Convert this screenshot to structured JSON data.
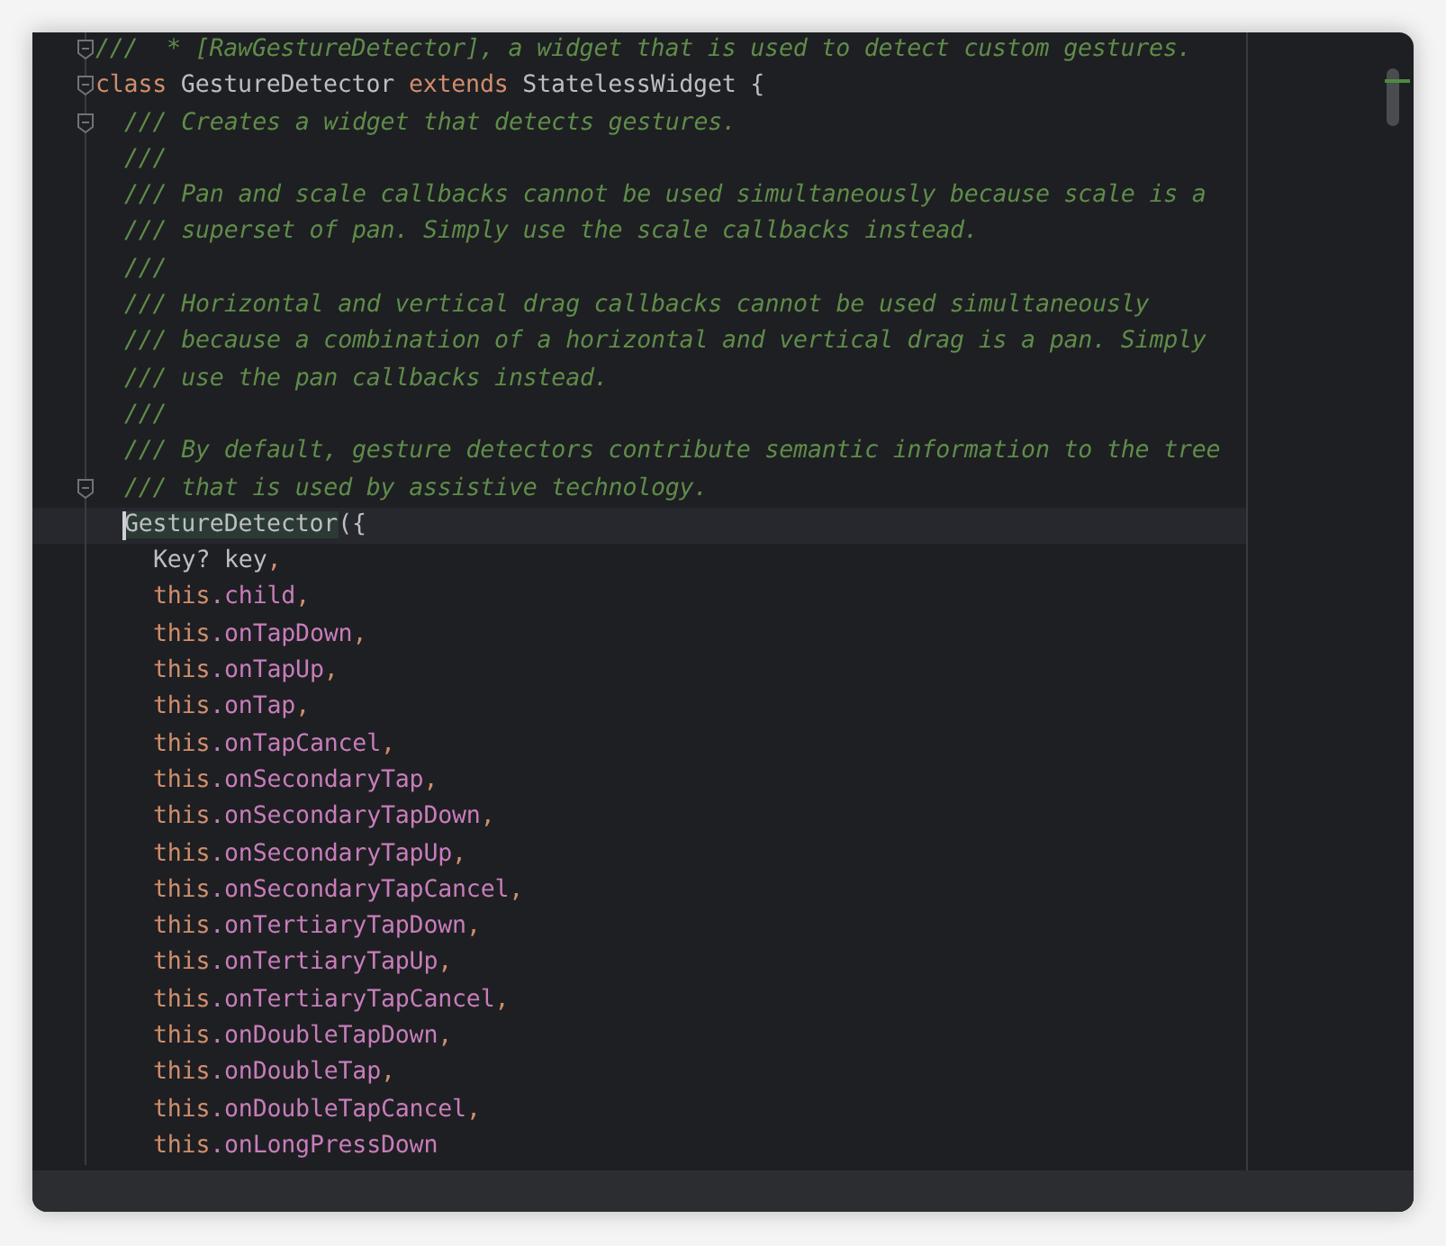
{
  "editor": {
    "lines": [
      {
        "kind": "top",
        "fold": true,
        "current": false,
        "tokens": [
          {
            "kind": "comment",
            "text": "///  * [RawGestureDetector], a widget that is used to detect custom gestures."
          }
        ]
      },
      {
        "kind": "top",
        "fold": true,
        "current": false,
        "tokens": [
          {
            "kind": "keyword",
            "text": "class"
          },
          {
            "kind": "plain",
            "text": " GestureDetector "
          },
          {
            "kind": "keyword",
            "text": "extends"
          },
          {
            "kind": "plain",
            "text": " StatelessWidget {"
          }
        ]
      },
      {
        "kind": "body",
        "fold": true,
        "current": false,
        "tokens": [
          {
            "kind": "comment",
            "text": "/// Creates a widget that detects gestures."
          }
        ]
      },
      {
        "kind": "body",
        "fold": false,
        "current": false,
        "tokens": [
          {
            "kind": "comment",
            "text": "///"
          }
        ]
      },
      {
        "kind": "body",
        "fold": false,
        "current": false,
        "tokens": [
          {
            "kind": "comment",
            "text": "/// Pan and scale callbacks cannot be used simultaneously because scale is a"
          }
        ]
      },
      {
        "kind": "body",
        "fold": false,
        "current": false,
        "tokens": [
          {
            "kind": "comment",
            "text": "/// superset of pan. Simply use the scale callbacks instead."
          }
        ]
      },
      {
        "kind": "body",
        "fold": false,
        "current": false,
        "tokens": [
          {
            "kind": "comment",
            "text": "///"
          }
        ]
      },
      {
        "kind": "body",
        "fold": false,
        "current": false,
        "tokens": [
          {
            "kind": "comment",
            "text": "/// Horizontal and vertical drag callbacks cannot be used simultaneously"
          }
        ]
      },
      {
        "kind": "body",
        "fold": false,
        "current": false,
        "tokens": [
          {
            "kind": "comment",
            "text": "/// because a combination of a horizontal and vertical drag is a pan. Simply"
          }
        ]
      },
      {
        "kind": "body",
        "fold": false,
        "current": false,
        "tokens": [
          {
            "kind": "comment",
            "text": "/// use the pan callbacks instead."
          }
        ]
      },
      {
        "kind": "body",
        "fold": false,
        "current": false,
        "tokens": [
          {
            "kind": "comment",
            "text": "///"
          }
        ]
      },
      {
        "kind": "body",
        "fold": false,
        "current": false,
        "tokens": [
          {
            "kind": "comment",
            "text": "/// By default, gesture detectors contribute semantic information to the tree"
          }
        ]
      },
      {
        "kind": "body",
        "fold": true,
        "current": false,
        "tokens": [
          {
            "kind": "comment",
            "text": "/// that is used by assistive technology."
          }
        ]
      },
      {
        "kind": "body",
        "fold": false,
        "current": true,
        "tokens": [
          {
            "kind": "usage",
            "text": "GestureDetector"
          },
          {
            "kind": "plain",
            "text": "({"
          }
        ]
      },
      {
        "kind": "param",
        "fold": false,
        "current": false,
        "tokens": [
          {
            "kind": "plain",
            "text": "Key? key"
          },
          {
            "kind": "keyword",
            "text": ","
          }
        ]
      },
      {
        "kind": "param",
        "fold": false,
        "current": false,
        "tokens": [
          {
            "kind": "keyword",
            "text": "this"
          },
          {
            "kind": "field",
            "text": ".child"
          },
          {
            "kind": "keyword",
            "text": ","
          }
        ]
      },
      {
        "kind": "param",
        "fold": false,
        "current": false,
        "tokens": [
          {
            "kind": "keyword",
            "text": "this"
          },
          {
            "kind": "field",
            "text": ".onTapDown"
          },
          {
            "kind": "keyword",
            "text": ","
          }
        ]
      },
      {
        "kind": "param",
        "fold": false,
        "current": false,
        "tokens": [
          {
            "kind": "keyword",
            "text": "this"
          },
          {
            "kind": "field",
            "text": ".onTapUp"
          },
          {
            "kind": "keyword",
            "text": ","
          }
        ]
      },
      {
        "kind": "param",
        "fold": false,
        "current": false,
        "tokens": [
          {
            "kind": "keyword",
            "text": "this"
          },
          {
            "kind": "field",
            "text": ".onTap"
          },
          {
            "kind": "keyword",
            "text": ","
          }
        ]
      },
      {
        "kind": "param",
        "fold": false,
        "current": false,
        "tokens": [
          {
            "kind": "keyword",
            "text": "this"
          },
          {
            "kind": "field",
            "text": ".onTapCancel"
          },
          {
            "kind": "keyword",
            "text": ","
          }
        ]
      },
      {
        "kind": "param",
        "fold": false,
        "current": false,
        "tokens": [
          {
            "kind": "keyword",
            "text": "this"
          },
          {
            "kind": "field",
            "text": ".onSecondaryTap"
          },
          {
            "kind": "keyword",
            "text": ","
          }
        ]
      },
      {
        "kind": "param",
        "fold": false,
        "current": false,
        "tokens": [
          {
            "kind": "keyword",
            "text": "this"
          },
          {
            "kind": "field",
            "text": ".onSecondaryTapDown"
          },
          {
            "kind": "keyword",
            "text": ","
          }
        ]
      },
      {
        "kind": "param",
        "fold": false,
        "current": false,
        "tokens": [
          {
            "kind": "keyword",
            "text": "this"
          },
          {
            "kind": "field",
            "text": ".onSecondaryTapUp"
          },
          {
            "kind": "keyword",
            "text": ","
          }
        ]
      },
      {
        "kind": "param",
        "fold": false,
        "current": false,
        "tokens": [
          {
            "kind": "keyword",
            "text": "this"
          },
          {
            "kind": "field",
            "text": ".onSecondaryTapCancel"
          },
          {
            "kind": "keyword",
            "text": ","
          }
        ]
      },
      {
        "kind": "param",
        "fold": false,
        "current": false,
        "tokens": [
          {
            "kind": "keyword",
            "text": "this"
          },
          {
            "kind": "field",
            "text": ".onTertiaryTapDown"
          },
          {
            "kind": "keyword",
            "text": ","
          }
        ]
      },
      {
        "kind": "param",
        "fold": false,
        "current": false,
        "tokens": [
          {
            "kind": "keyword",
            "text": "this"
          },
          {
            "kind": "field",
            "text": ".onTertiaryTapUp"
          },
          {
            "kind": "keyword",
            "text": ","
          }
        ]
      },
      {
        "kind": "param",
        "fold": false,
        "current": false,
        "tokens": [
          {
            "kind": "keyword",
            "text": "this"
          },
          {
            "kind": "field",
            "text": ".onTertiaryTapCancel"
          },
          {
            "kind": "keyword",
            "text": ","
          }
        ]
      },
      {
        "kind": "param",
        "fold": false,
        "current": false,
        "tokens": [
          {
            "kind": "keyword",
            "text": "this"
          },
          {
            "kind": "field",
            "text": ".onDoubleTapDown"
          },
          {
            "kind": "keyword",
            "text": ","
          }
        ]
      },
      {
        "kind": "param",
        "fold": false,
        "current": false,
        "tokens": [
          {
            "kind": "keyword",
            "text": "this"
          },
          {
            "kind": "field",
            "text": ".onDoubleTap"
          },
          {
            "kind": "keyword",
            "text": ","
          }
        ]
      },
      {
        "kind": "param",
        "fold": false,
        "current": false,
        "tokens": [
          {
            "kind": "keyword",
            "text": "this"
          },
          {
            "kind": "field",
            "text": ".onDoubleTapCancel"
          },
          {
            "kind": "keyword",
            "text": ","
          }
        ]
      },
      {
        "kind": "param",
        "fold": false,
        "current": false,
        "tokens": [
          {
            "kind": "keyword",
            "text": "this"
          },
          {
            "kind": "field",
            "text": ".onLongPressDown"
          }
        ]
      }
    ]
  }
}
